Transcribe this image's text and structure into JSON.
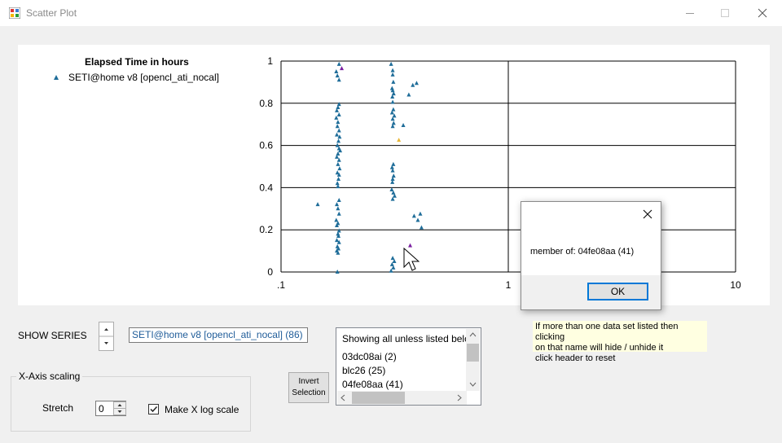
{
  "window": {
    "title": "Scatter Plot"
  },
  "chart_data": {
    "type": "scatter",
    "title": "Elapsed Time in hours",
    "x_scale": "log",
    "xlim": [
      0.1,
      10
    ],
    "ylim": [
      0,
      1
    ],
    "x_ticks": [
      ".1",
      "1",
      "10"
    ],
    "y_ticks": [
      "0",
      "0.2",
      "0.4",
      "0.6",
      "0.8",
      "1"
    ],
    "grid": true,
    "legend_placement": "top-left",
    "series": [
      {
        "name": "SETI@home v8 [opencl_ati_nocal]",
        "color": "#1f6d99",
        "points": [
          [
            0.18,
            0.985
          ],
          [
            0.175,
            0.95
          ],
          [
            0.177,
            0.93
          ],
          [
            0.18,
            0.91
          ],
          [
            0.18,
            0.795
          ],
          [
            0.178,
            0.78
          ],
          [
            0.176,
            0.765
          ],
          [
            0.18,
            0.745
          ],
          [
            0.175,
            0.73
          ],
          [
            0.178,
            0.71
          ],
          [
            0.177,
            0.69
          ],
          [
            0.18,
            0.67
          ],
          [
            0.176,
            0.65
          ],
          [
            0.181,
            0.64
          ],
          [
            0.179,
            0.62
          ],
          [
            0.177,
            0.6
          ],
          [
            0.18,
            0.585
          ],
          [
            0.182,
            0.575
          ],
          [
            0.178,
            0.56
          ],
          [
            0.176,
            0.545
          ],
          [
            0.18,
            0.53
          ],
          [
            0.178,
            0.51
          ],
          [
            0.181,
            0.49
          ],
          [
            0.177,
            0.47
          ],
          [
            0.18,
            0.46
          ],
          [
            0.179,
            0.44
          ],
          [
            0.177,
            0.42
          ],
          [
            0.178,
            0.405
          ],
          [
            0.18,
            0.34
          ],
          [
            0.176,
            0.32
          ],
          [
            0.178,
            0.3
          ],
          [
            0.18,
            0.275
          ],
          [
            0.175,
            0.245
          ],
          [
            0.178,
            0.23
          ],
          [
            0.176,
            0.22
          ],
          [
            0.18,
            0.195
          ],
          [
            0.178,
            0.18
          ],
          [
            0.179,
            0.17
          ],
          [
            0.176,
            0.15
          ],
          [
            0.18,
            0.14
          ],
          [
            0.177,
            0.12
          ],
          [
            0.179,
            0.11
          ],
          [
            0.176,
            0.1
          ],
          [
            0.178,
            0.09
          ],
          [
            0.177,
            0.0
          ],
          [
            0.145,
            0.32
          ],
          [
            0.305,
            0.985
          ],
          [
            0.31,
            0.955
          ],
          [
            0.31,
            0.935
          ],
          [
            0.312,
            0.9
          ],
          [
            0.308,
            0.87
          ],
          [
            0.31,
            0.86
          ],
          [
            0.313,
            0.845
          ],
          [
            0.309,
            0.83
          ],
          [
            0.31,
            0.805
          ],
          [
            0.312,
            0.77
          ],
          [
            0.308,
            0.755
          ],
          [
            0.315,
            0.74
          ],
          [
            0.31,
            0.725
          ],
          [
            0.313,
            0.705
          ],
          [
            0.31,
            0.69
          ],
          [
            0.312,
            0.51
          ],
          [
            0.308,
            0.495
          ],
          [
            0.31,
            0.48
          ],
          [
            0.313,
            0.455
          ],
          [
            0.31,
            0.44
          ],
          [
            0.309,
            0.425
          ],
          [
            0.307,
            0.39
          ],
          [
            0.312,
            0.375
          ],
          [
            0.316,
            0.36
          ],
          [
            0.31,
            0.345
          ],
          [
            0.31,
            0.065
          ],
          [
            0.315,
            0.05
          ],
          [
            0.308,
            0.035
          ],
          [
            0.312,
            0.02
          ],
          [
            0.305,
            0.005
          ],
          [
            0.345,
            0.695
          ],
          [
            0.365,
            0.84
          ],
          [
            0.38,
            0.885
          ],
          [
            0.395,
            0.895
          ],
          [
            0.385,
            0.265
          ],
          [
            0.4,
            0.245
          ],
          [
            0.41,
            0.275
          ],
          [
            0.415,
            0.21
          ]
        ]
      },
      {
        "name": "",
        "color": "#7a1fa0",
        "points": [
          [
            0.185,
            0.965
          ],
          [
            0.37,
            0.125
          ]
        ]
      },
      {
        "name": "",
        "color": "#e8b83a",
        "points": [
          [
            0.33,
            0.625
          ]
        ]
      }
    ]
  },
  "dialog": {
    "message": "member of: 04fe08aa (41)",
    "ok_label": "OK"
  },
  "controls": {
    "show_series_label": "SHOW SERIES",
    "series_value": "SETI@home v8 [opencl_ati_nocal] (86)",
    "x_axis_group_label": "X-Axis scaling",
    "stretch_label": "Stretch",
    "stretch_value": "0",
    "log_checkbox_label": "Make X log scale",
    "log_checked": true,
    "invert_label_1": "Invert",
    "invert_label_2": "Selection"
  },
  "list": {
    "header": "Showing all unless listed below",
    "items": [
      "03dc08ai (2)",
      "blc26 (25)",
      "04fe08aa (41)"
    ]
  },
  "hint": {
    "line1": "If more than one data set listed then clicking",
    "line2": "on that name will hide / unhide it",
    "line3": "click header to reset"
  }
}
